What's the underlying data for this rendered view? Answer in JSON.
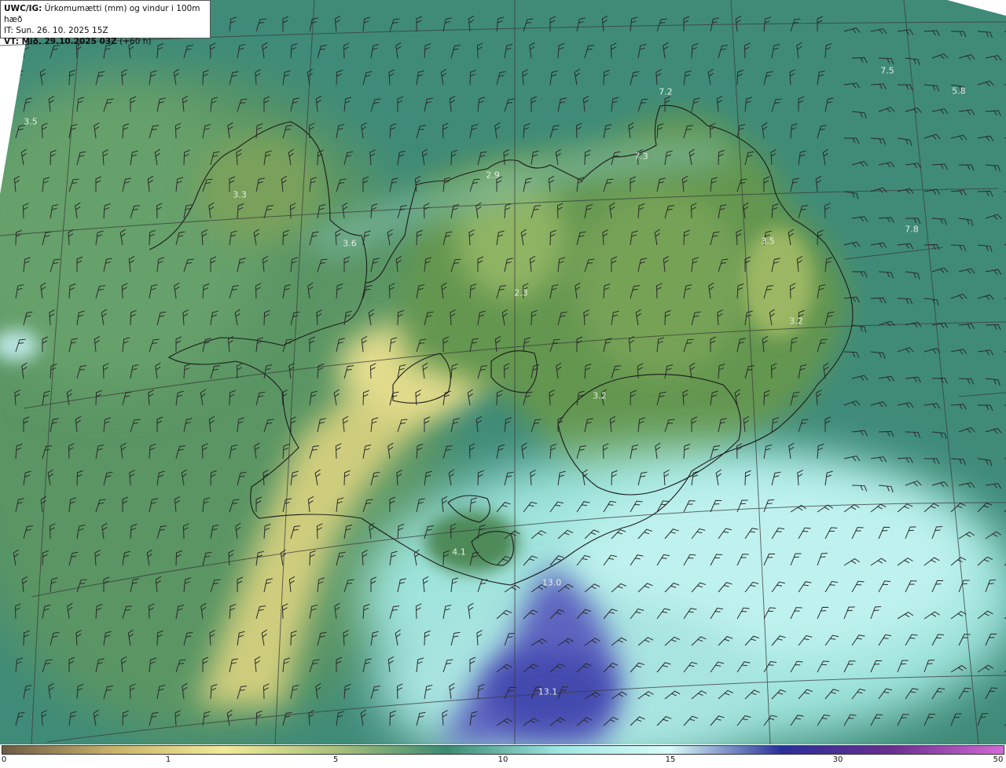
{
  "header": {
    "model_label": "UWC/IG:",
    "title": "Úrkomumætti (mm) og vindur i 100m hæð",
    "initial_time": "IT: Sun. 26. 10. 2025 15Z",
    "valid_prefix": "VT: Mið. 29.10.2025 03Z",
    "valid_suffix": "(+60 h)"
  },
  "value_labels": [
    {
      "text": "3.5"
    },
    {
      "text": "3.3"
    },
    {
      "text": "3.6"
    },
    {
      "text": "2.9"
    },
    {
      "text": "7.2"
    },
    {
      "text": "7.3"
    },
    {
      "text": "7.5"
    },
    {
      "text": "5.8"
    },
    {
      "text": "7.8"
    },
    {
      "text": "3.5"
    },
    {
      "text": "2.3"
    },
    {
      "text": "3.2"
    },
    {
      "text": "3.2"
    },
    {
      "text": "4.1"
    },
    {
      "text": "13.0"
    },
    {
      "text": "13.1"
    }
  ],
  "colorbar": {
    "ticks": [
      {
        "label": "0",
        "value": 0
      },
      {
        "label": "1",
        "value": 1
      },
      {
        "label": "5",
        "value": 5
      },
      {
        "label": "10",
        "value": 10
      },
      {
        "label": "15",
        "value": 15
      },
      {
        "label": "30",
        "value": 30
      },
      {
        "label": "50",
        "value": 50
      }
    ],
    "colors": [
      "#6e5a45",
      "#c9b36a",
      "#f2ea9a",
      "#a9c07a",
      "#3c8a72",
      "#9fe6e3",
      "#d9fbf8",
      "#2a2f9a",
      "#6b2f8f",
      "#d36ad6"
    ]
  },
  "colors": {
    "land_dark": "#4d8a5c",
    "land_light": "#d8d585",
    "sea": "#3e8a78",
    "high_precip": "#4a4fb0",
    "light_cyan": "#aeeeec"
  }
}
